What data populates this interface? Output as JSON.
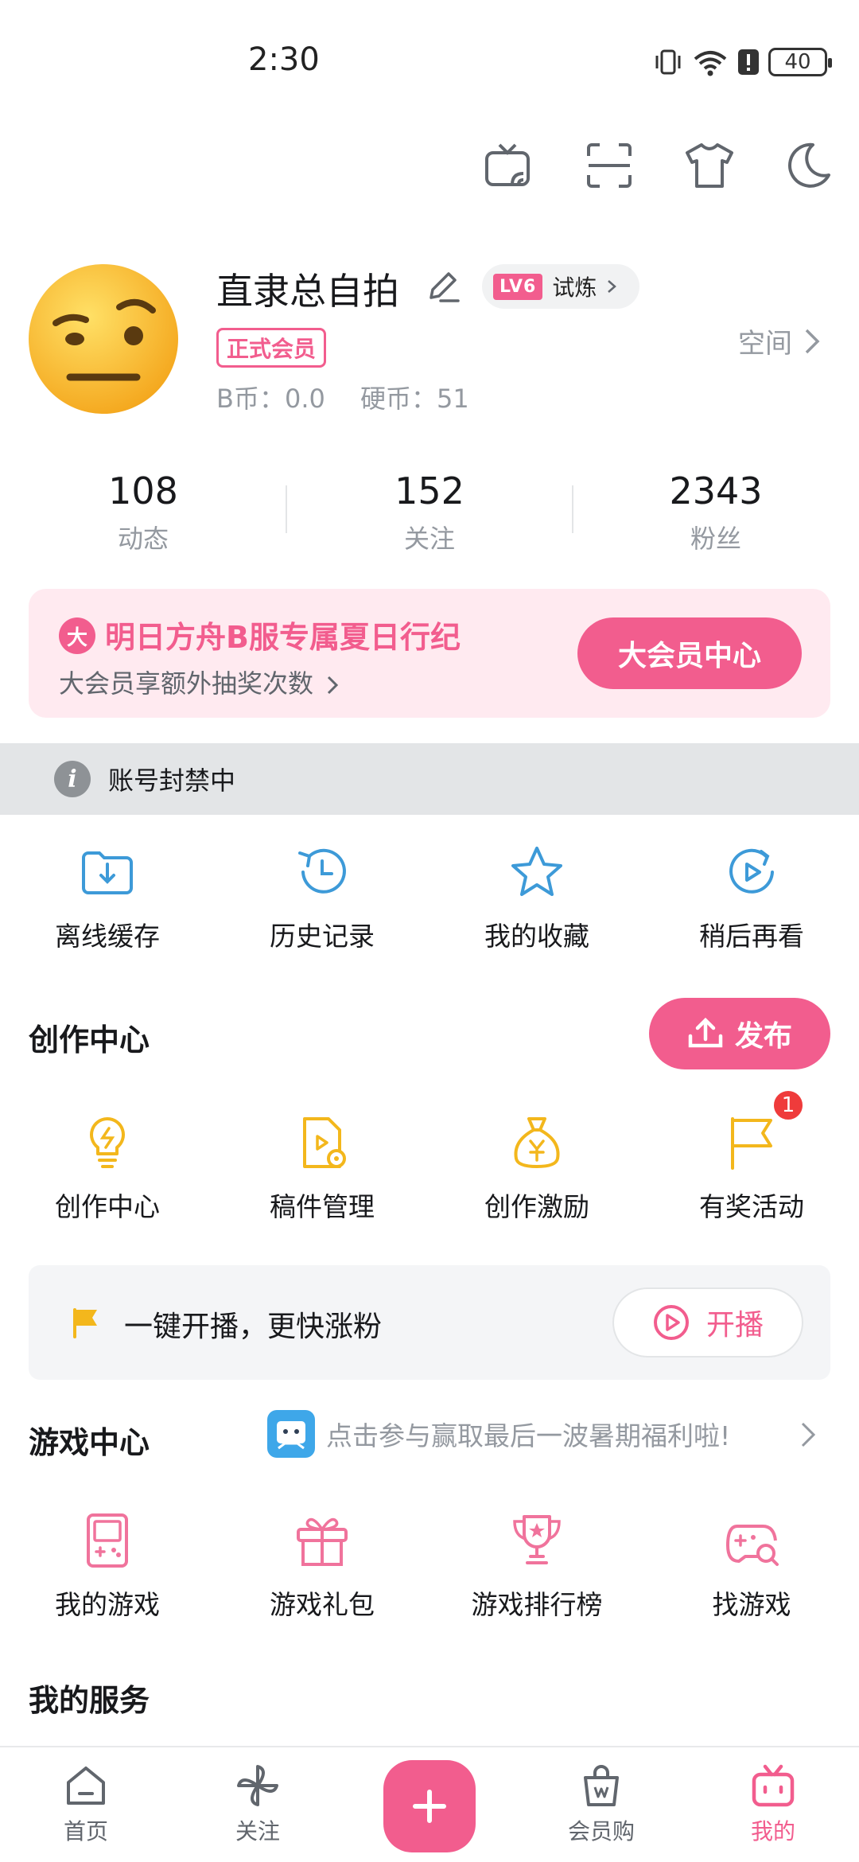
{
  "status_bar": {
    "time": "2:30",
    "battery": "40",
    "network": "6"
  },
  "profile": {
    "username": "直隶总自拍",
    "level_badge": "LV6",
    "level_text": "试炼",
    "vip_tag": "正式会员",
    "b_coin": "B币：0.0",
    "hard_coin": "硬币：51",
    "space_link": "空间"
  },
  "stats": [
    {
      "value": "108",
      "label": "动态"
    },
    {
      "value": "152",
      "label": "关注"
    },
    {
      "value": "2343",
      "label": "粉丝"
    }
  ],
  "vip_banner": {
    "icon_text": "大",
    "title": "明日方舟B服专属夏日行纪",
    "subtitle": "大会员享额外抽奖次数",
    "button": "大会员中心"
  },
  "notice": {
    "icon": "i",
    "text": "账号封禁中"
  },
  "quick_items": [
    {
      "label": "离线缓存",
      "icon": "offline-download-icon"
    },
    {
      "label": "历史记录",
      "icon": "history-icon"
    },
    {
      "label": "我的收藏",
      "icon": "star-icon"
    },
    {
      "label": "稍后再看",
      "icon": "watch-later-icon"
    }
  ],
  "creation": {
    "title": "创作中心",
    "publish_button": "发布",
    "items": [
      {
        "label": "创作中心",
        "icon": "lightbulb-icon"
      },
      {
        "label": "稿件管理",
        "icon": "manuscript-icon"
      },
      {
        "label": "创作激励",
        "icon": "money-bag-icon"
      },
      {
        "label": "有奖活动",
        "icon": "flag-icon",
        "badge": "1"
      }
    ]
  },
  "live_card": {
    "text": "一键开播，更快涨粉",
    "button": "开播"
  },
  "game_center": {
    "title": "游戏中心",
    "promo": "点击参与赢取最后一波暑期福利啦!",
    "items": [
      {
        "label": "我的游戏",
        "icon": "gameboy-icon"
      },
      {
        "label": "游戏礼包",
        "icon": "gift-icon"
      },
      {
        "label": "游戏排行榜",
        "icon": "trophy-icon"
      },
      {
        "label": "找游戏",
        "icon": "gamepad-search-icon"
      }
    ]
  },
  "services": {
    "title": "我的服务"
  },
  "bottom_nav": [
    {
      "label": "首页",
      "icon": "home-icon"
    },
    {
      "label": "关注",
      "icon": "pinwheel-icon"
    },
    {
      "label": "",
      "icon": "plus-icon"
    },
    {
      "label": "会员购",
      "icon": "shopping-bag-icon"
    },
    {
      "label": "我的",
      "icon": "tv-mascot-icon"
    }
  ],
  "colors": {
    "accent": "#f25d8e",
    "blue_icon": "#3d9ad8",
    "yellow_icon": "#f3b71c",
    "pink_icon": "#f0739c"
  }
}
